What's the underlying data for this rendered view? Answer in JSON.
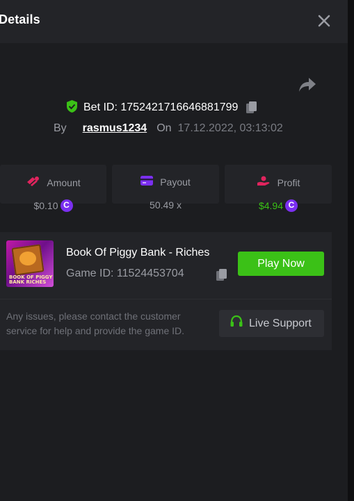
{
  "header": {
    "title": "Details"
  },
  "bet": {
    "id_label": "Bet ID: 1752421716646881799",
    "by_label": "By",
    "username": "rasmus1234",
    "on_label": "On",
    "datetime": "17.12.2022, 03:13:02"
  },
  "stats": [
    {
      "label": "Amount",
      "value": "$0.10",
      "has_coin": true,
      "icon": "coins-icon",
      "icon_color": "#e0245e"
    },
    {
      "label": "Payout",
      "value": "50.49 x",
      "has_coin": false,
      "icon": "card-icon",
      "icon_color": "#7b2ff0"
    },
    {
      "label": "Profit",
      "value": "$4.94",
      "has_coin": true,
      "icon": "hand-coin-icon",
      "icon_color": "#e0245e",
      "value_color": "#3bc117"
    }
  ],
  "coin_symbol": "C",
  "game": {
    "name": "Book Of Piggy Bank - Riches",
    "id_label": "Game ID: 11524453704",
    "thumbnail_text": "BOOK OF PIGGY BANK RICHES",
    "play_label": "Play Now"
  },
  "support": {
    "help_text": "Any issues, please contact the customer service for help and provide the game ID.",
    "button_label": "Live Support"
  },
  "colors": {
    "accent_green": "#3bc117",
    "coin_purple": "#7b2ff0",
    "panel_bg": "#232428",
    "page_bg": "#1c1d20"
  }
}
